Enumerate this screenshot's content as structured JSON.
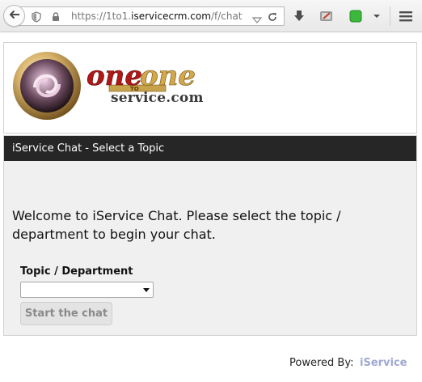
{
  "browser": {
    "url_prefix": "https://1to1.",
    "url_domain": "iservicecrm.com",
    "url_path": "/f/chat"
  },
  "logo": {
    "word_one": "one",
    "word_to": "TO",
    "word_one2": "one",
    "domain": "service.com"
  },
  "chat": {
    "header": "iService Chat - Select a Topic",
    "welcome": "Welcome to iService Chat. Please select the topic / department to begin your chat.",
    "topic_label": "Topic / Department",
    "topic_value": "",
    "start_button": "Start the chat"
  },
  "footer": {
    "powered_by": "Powered By:",
    "brand": "iService"
  },
  "colors": {
    "header_bg": "#262626",
    "panel_bg": "#f0f0f0",
    "brand_red": "#b01818",
    "brand_gold": "#c8a24a"
  }
}
